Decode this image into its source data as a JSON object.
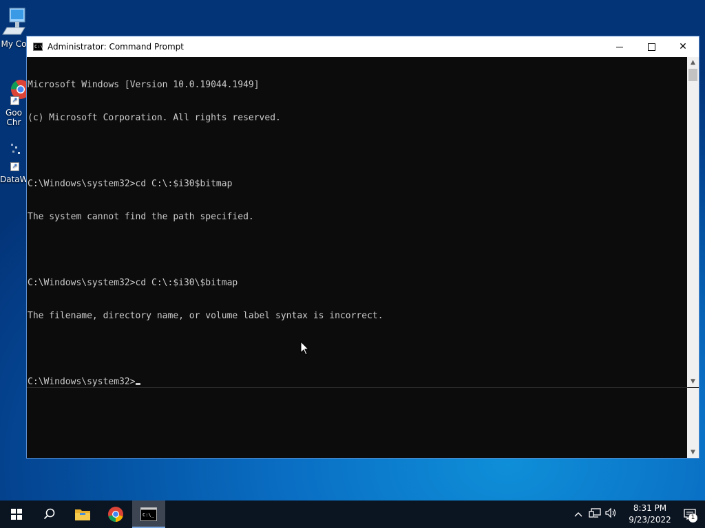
{
  "desktop": {
    "icons": [
      {
        "label": "My Co",
        "icon": "computer-icon"
      },
      {
        "label": "Goo\nChr",
        "icon": "chrome-icon"
      },
      {
        "label": "DataW",
        "icon": "datawrapper-icon"
      }
    ]
  },
  "window": {
    "title": "Administrator: Command Prompt",
    "icon": "cmd-icon",
    "controls": {
      "minimize": "minimize",
      "maximize": "maximize",
      "close": "✕"
    }
  },
  "console": {
    "lines": [
      "Microsoft Windows [Version 10.0.19044.1949]",
      "(c) Microsoft Corporation. All rights reserved.",
      "",
      "C:\\Windows\\system32>cd C:\\:$i30$bitmap",
      "The system cannot find the path specified.",
      "",
      "C:\\Windows\\system32>cd C:\\:$i30\\$bitmap",
      "The filename, directory name, or volume label syntax is incorrect.",
      "",
      "C:\\Windows\\system32>"
    ]
  },
  "taskbar": {
    "items": [
      {
        "name": "start",
        "icon": "windows-logo-icon"
      },
      {
        "name": "search",
        "icon": "search-icon"
      },
      {
        "name": "file-explorer",
        "icon": "folder-icon"
      },
      {
        "name": "chrome",
        "icon": "chrome-icon"
      },
      {
        "name": "command-prompt",
        "icon": "cmd-icon",
        "active": true
      }
    ],
    "clock": {
      "time": "8:31 PM",
      "date": "9/23/2022"
    },
    "notification_count": "1"
  },
  "colors": {
    "console_bg": "#0c0c0c",
    "console_fg": "#cccccc",
    "taskbar_bg": "#0b1421"
  }
}
